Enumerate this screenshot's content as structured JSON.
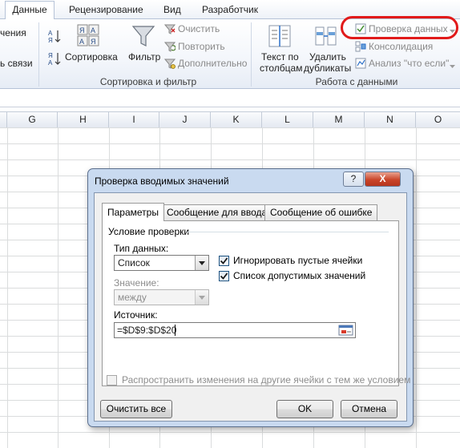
{
  "ribbon": {
    "tabs": [
      {
        "label": "Данные",
        "active": true
      },
      {
        "label": "Рецензирование",
        "active": false
      },
      {
        "label": "Вид",
        "active": false
      },
      {
        "label": "Разработчик",
        "active": false
      }
    ],
    "left_partial": {
      "line1": "чения",
      "line2": "ь связи"
    },
    "sort_group": {
      "sort_label": "Сортировка",
      "filter_label": "Фильтр",
      "clear": "Очистить",
      "reapply": "Повторить",
      "advanced": "Дополнительно",
      "group_label": "Сортировка и фильтр"
    },
    "data_group": {
      "text_to_columns_1": "Текст по",
      "text_to_columns_2": "столбцам",
      "remove_dupes_1": "Удалить",
      "remove_dupes_2": "дубликаты",
      "data_validation": "Проверка данных",
      "consolidate": "Консолидация",
      "what_if": "Анализ \"что если\"",
      "group_label": "Работа с данными"
    },
    "accent_highlight": "#e11a1a"
  },
  "sheet": {
    "columns": [
      "G",
      "H",
      "I",
      "J",
      "K",
      "L",
      "M",
      "N",
      "O"
    ]
  },
  "dialog": {
    "title": "Проверка вводимых значений",
    "help": "?",
    "close": "X",
    "tabs": [
      "Параметры",
      "Сообщение для ввода",
      "Сообщение об ошибке"
    ],
    "section_title": "Условие проверки",
    "data_type_label": "Тип данных:",
    "data_type_value": "Список",
    "value_label": "Значение:",
    "value_value": "между",
    "ignore_blank_label": "Игнорировать пустые ячейки",
    "ignore_blank_checked": true,
    "dropdown_label": "Список допустимых значений",
    "dropdown_checked": true,
    "source_label": "Источник:",
    "source_value": "=$D$9:$D$20",
    "apply_all_label": "Распространить изменения на другие ячейки с тем же условием",
    "apply_all_checked": false,
    "clear_all": "Очистить все",
    "ok": "OK",
    "cancel": "Отмена"
  }
}
